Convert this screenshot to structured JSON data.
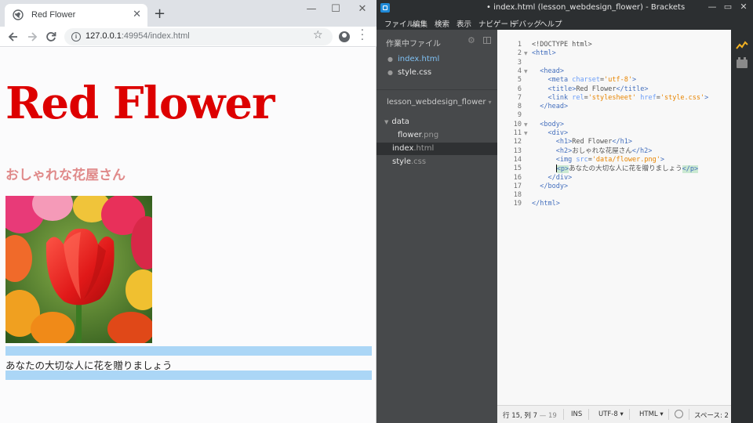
{
  "browser": {
    "tab_title": "Red Flower",
    "tab_close": "✕",
    "new_tab": "+",
    "window_controls": {
      "minimize": "—",
      "maximize": "☐",
      "close": "✕"
    },
    "url_host": "127.0.0.1",
    "url_rest": ":49954/index.html",
    "icons": {
      "back": "arrow-left",
      "forward": "arrow-right",
      "reload": "reload",
      "info": "info",
      "bookmark": "star",
      "account": "account",
      "menu": "more-vert"
    }
  },
  "page": {
    "h1": "Red Flower",
    "h2": "おしゃれな花屋さん",
    "p": "あなたの大切な人に花を贈りましょう",
    "colors": {
      "h1": "#dd0000",
      "h2": "#e08a8a",
      "highlight": "#abd6f6"
    }
  },
  "editor": {
    "window_title": "• index.html (lesson_webdesign_flower) - Brackets",
    "menu": [
      "ファイル",
      "編集",
      "検索",
      "表示",
      "ナビゲート",
      "デバッグ",
      "ヘルプ"
    ],
    "working_files_label": "作業中ファイル",
    "working_files": [
      {
        "name": "index.html",
        "active": true
      },
      {
        "name": "style.css",
        "active": false
      }
    ],
    "project_name": "lesson_webdesign_flower",
    "tree": {
      "folder": "data",
      "folder_file_name": "flower",
      "folder_file_ext": ".png",
      "index_name": "index",
      "index_ext": ".html",
      "style_name": "style",
      "style_ext": ".css"
    },
    "line_numbers": [
      "1",
      "2",
      "3",
      "4",
      "5",
      "6",
      "7",
      "8",
      "9",
      "10",
      "11",
      "12",
      "13",
      "14",
      "15",
      "16",
      "17",
      "18",
      "19"
    ],
    "status": {
      "position": "行 15, 列 7",
      "position_sub": "— 19",
      "mode_ins": "INS",
      "encoding": "UTF-8",
      "language": "HTML",
      "spaces": "スペース: 2"
    }
  }
}
